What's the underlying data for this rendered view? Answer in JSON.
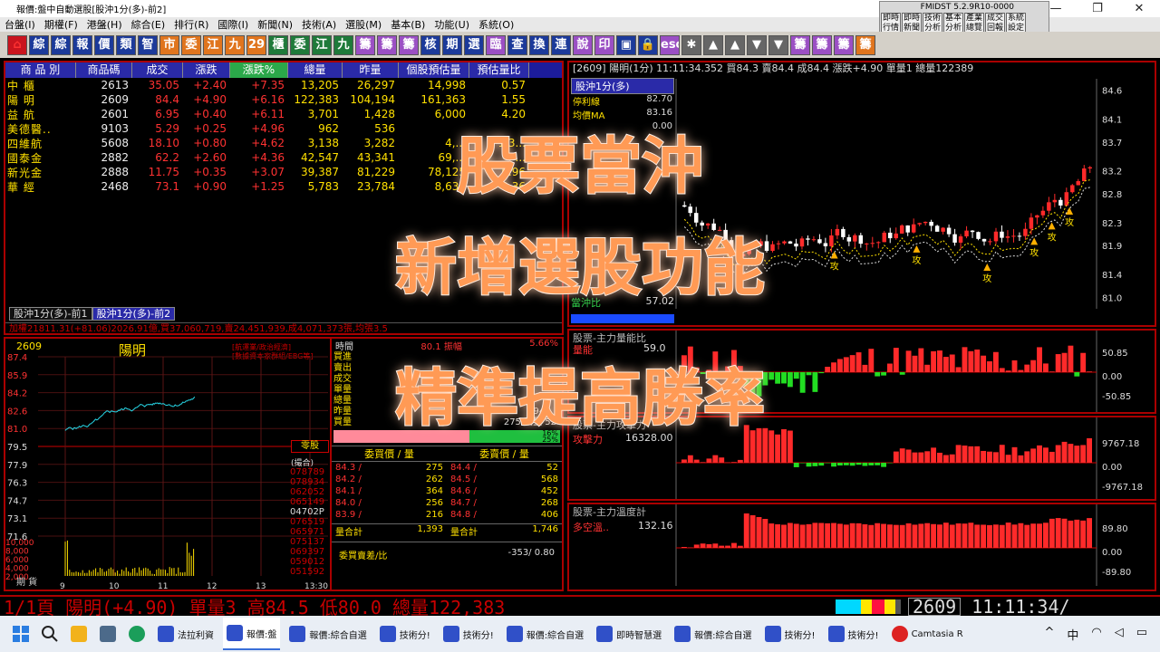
{
  "window": {
    "title": "報價:盤中自動選股[股沖1分(多)-前2]",
    "controls": [
      "—",
      "❐",
      "✕"
    ]
  },
  "menu": [
    "台盤(I)",
    "期權(F)",
    "港盤(H)",
    "綜合(E)",
    "排行(R)",
    "國際(I)",
    "新聞(N)",
    "技術(A)",
    "選股(M)",
    "基本(B)",
    "功能(U)",
    "系統(O)"
  ],
  "fmi": {
    "title": "FMIDST 5.2.9R10-0000",
    "buttons": [
      "即時行情",
      "即時新聞",
      "技術分析",
      "基本分析",
      "產業總覽",
      "成交回報",
      "系統設定"
    ]
  },
  "toolbar": [
    {
      "t": "⌂",
      "c": "red"
    },
    {
      "t": "綜",
      "c": "blue"
    },
    {
      "t": "綜",
      "c": "blue"
    },
    {
      "t": "報",
      "c": "blue"
    },
    {
      "t": "價",
      "c": "blue"
    },
    {
      "t": "類",
      "c": "blue"
    },
    {
      "t": "智",
      "c": "blue"
    },
    {
      "t": "市",
      "c": "orange"
    },
    {
      "t": "委",
      "c": "orange"
    },
    {
      "t": "江",
      "c": "orange"
    },
    {
      "t": "九",
      "c": "orange"
    },
    {
      "t": "29",
      "c": "orange"
    },
    {
      "t": "櫃",
      "c": "green"
    },
    {
      "t": "委",
      "c": "green"
    },
    {
      "t": "江",
      "c": "green"
    },
    {
      "t": "九",
      "c": "green"
    },
    {
      "t": "籌",
      "c": "purple"
    },
    {
      "t": "籌",
      "c": "purple"
    },
    {
      "t": "籌",
      "c": "purple"
    },
    {
      "t": "核",
      "c": "blue"
    },
    {
      "t": "期",
      "c": "blue"
    },
    {
      "t": "選",
      "c": "blue"
    },
    {
      "t": "臨",
      "c": "purple"
    },
    {
      "t": "查",
      "c": "blue"
    },
    {
      "t": "換",
      "c": "blue"
    },
    {
      "t": "連",
      "c": "blue"
    },
    {
      "t": "說",
      "c": "purple"
    },
    {
      "t": "印",
      "c": "purple"
    },
    {
      "t": "▣",
      "c": "blue"
    },
    {
      "t": "🔒",
      "c": "blue"
    },
    {
      "t": "esc",
      "c": "purple"
    },
    {
      "t": "✱",
      "c": "gray"
    },
    {
      "t": "▲",
      "c": "gray"
    },
    {
      "t": "▲",
      "c": "gray"
    },
    {
      "t": "▼",
      "c": "gray"
    },
    {
      "t": "▼",
      "c": "gray"
    },
    {
      "t": "籌",
      "c": "purple"
    },
    {
      "t": "籌",
      "c": "purple"
    },
    {
      "t": "籌",
      "c": "purple"
    },
    {
      "t": "籌",
      "c": "orange"
    }
  ],
  "table": {
    "headers": [
      "商 品 別",
      "商品碼",
      "成交",
      "漲跌",
      "漲跌%",
      "總量",
      "昨量",
      "個股預估量",
      "預估量比"
    ],
    "rows": [
      [
        "中 櫃",
        "2613",
        "35.05",
        "+2.40",
        "+7.35",
        "13,205",
        "26,297",
        "14,998",
        "0.57"
      ],
      [
        "陽 明",
        "2609",
        "84.4",
        "+4.90",
        "+6.16",
        "122,383",
        "104,194",
        "161,363",
        "1.55"
      ],
      [
        "益 航",
        "2601",
        "6.95",
        "+0.40",
        "+6.11",
        "3,701",
        "1,428",
        "6,000",
        "4.20"
      ],
      [
        "美德醫..",
        "9103",
        "5.29",
        "+0.25",
        "+4.96",
        "962",
        "536",
        "",
        ""
      ],
      [
        "四維航",
        "5608",
        "18.10",
        "+0.80",
        "+4.62",
        "3,138",
        "3,282",
        "4,...",
        "1.3..."
      ],
      [
        "國泰金",
        "2882",
        "62.2",
        "+2.60",
        "+4.36",
        "42,547",
        "43,341",
        "69,...",
        "..."
      ],
      [
        "新光金",
        "2888",
        "11.75",
        "+0.35",
        "+3.07",
        "39,387",
        "81,229",
        "78,125",
        "0.96"
      ],
      [
        "華 經",
        "2468",
        "73.1",
        "+0.90",
        "+1.25",
        "5,783",
        "23,784",
        "8,631",
        "0.36"
      ]
    ],
    "tabs": [
      "股沖1分(多)-前1",
      "股沖1分(多)-前2"
    ],
    "ticker": "加權21811.31(+81.06)2026.91億,買37,060,719,賣24,451,939,成4,071,373張,均張3.5"
  },
  "chart_top": {
    "header": "[2609] 陽明(1分)   11:11:34.352 買84.3 賣84.4 成84.4 漲跌+4.90 單量1 總量122389",
    "legend_title": "股沖1分(多)",
    "legend": [
      {
        "label": "停利線",
        "value": "82.70"
      },
      {
        "label": "均價MA",
        "value": "83.16"
      },
      {
        "label": "",
        "value": "0.00"
      }
    ],
    "yticks": [
      "84.6",
      "84.1",
      "83.7",
      "83.2",
      "82.8",
      "82.3",
      "81.9",
      "81.4",
      "81.0"
    ],
    "signal": "攻",
    "ratio_label": "當沖比",
    "ratio_value": "57.02"
  },
  "panel_vr": {
    "title": "股票-主力量能比",
    "label": "量能",
    "value": "59.0",
    "yticks": [
      "50.85",
      "0.00",
      "-50.85"
    ]
  },
  "panel_att": {
    "title": "股票-主力攻擊力",
    "label": "攻擊力",
    "value": "16328.00",
    "yticks": [
      "9767.18",
      "0.00",
      "-9767.18"
    ]
  },
  "panel_temp": {
    "title": "股票-主力溫度計",
    "label": "多空溫..",
    "value": "132.16",
    "yticks": [
      "89.80",
      "0.00",
      "-89.80"
    ]
  },
  "intraday": {
    "code": "2609",
    "name": "陽明",
    "note1": "[航運業/政治經濟]",
    "note2": "[數據資本家群組/EBG等]",
    "yticks": [
      "87.4",
      "85.9",
      "84.2",
      "82.6",
      "81.0",
      "79.5",
      "77.9",
      "76.3",
      "74.7",
      "73.1",
      "71.6"
    ],
    "vticks": [
      "10,000",
      "8,000",
      "6,000",
      "4,000",
      "2,000"
    ],
    "xticks": [
      "9",
      "10",
      "11",
      "12",
      "13",
      "13:30"
    ],
    "period_label": "期 貨"
  },
  "quote": {
    "top": [
      "時間",
      "80.1 振幅",
      "5.66%"
    ],
    "rows": [
      "買進",
      "賣出",
      "成交",
      "單量",
      "總量",
      "昨量",
      "買量"
    ],
    "row_vals": [
      "",
      "",
      "",
      "",
      "",
      "94 ...",
      "275 賣量 52"
    ],
    "pct": [
      "16%",
      "25%"
    ],
    "btn": "零股",
    "btn2": "(撮合)",
    "seq": [
      "078789",
      "078934",
      "062052",
      "065149",
      "04702P",
      "076519",
      "065971",
      "075137",
      "069397",
      "059012",
      "051592"
    ],
    "bid_hdr": "委買價 / 量",
    "ask_hdr": "委賣價 / 量",
    "bids": [
      [
        "84.3 /",
        "275"
      ],
      [
        "84.2 /",
        "262"
      ],
      [
        "84.1 /",
        "364"
      ],
      [
        "84.0 /",
        "256"
      ],
      [
        "83.9 /",
        "216"
      ]
    ],
    "asks": [
      [
        "84.4 /",
        "52"
      ],
      [
        "84.5 /",
        "568"
      ],
      [
        "84.6 /",
        "452"
      ],
      [
        "84.7 /",
        "268"
      ],
      [
        "84.8 /",
        "406"
      ]
    ],
    "sum_label": "量合計",
    "sum_bid": "1,393",
    "sum_ask": "1,746",
    "diff_label": "委買賣差/比",
    "diff_val": "-353/ 0.80"
  },
  "overlay": [
    "股票當沖",
    "新增選股功能",
    "精準提高勝率"
  ],
  "status": {
    "left": "1/1頁 陽明(+4.90) 單量3 高84.5 低80.0 總量122,383",
    "code": "2609",
    "time": "11:11:34/"
  },
  "taskbar": {
    "items": [
      "法拉利資",
      "報價:盤",
      "報價:綜合自選",
      "技術分!",
      "技術分!",
      "報價:綜合自選",
      "即時智慧選",
      "報價:綜合自選",
      "技術分!",
      "技術分!",
      "Camtasia R"
    ],
    "tray": [
      "^",
      "中"
    ]
  },
  "colors": {
    "up": "#ff3232",
    "down": "#22dd22",
    "accent": "#ff9a55",
    "panel_border": "#aa0000"
  }
}
